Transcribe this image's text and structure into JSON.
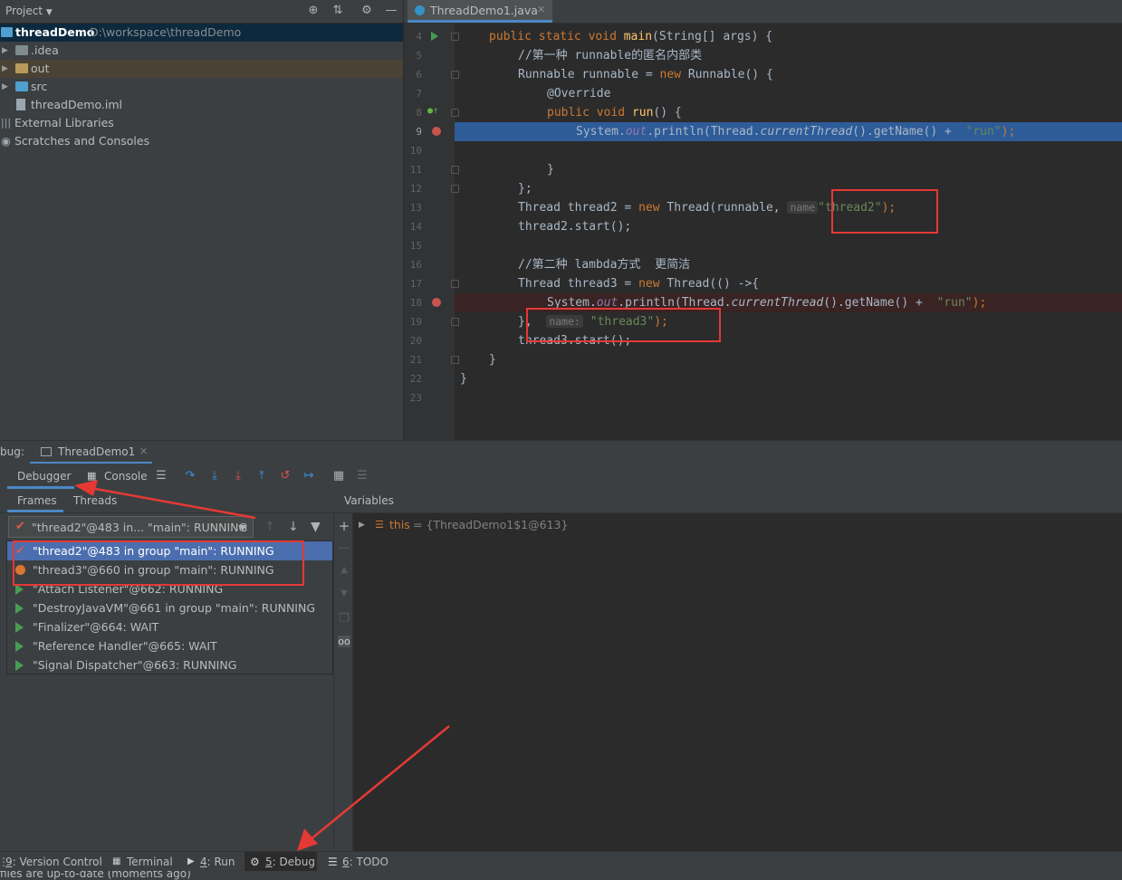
{
  "project": {
    "title": "Project",
    "root_name": "threadDemo",
    "root_path": "D:\\workspace\\threadDemo",
    "items": [
      ".idea",
      "out",
      "src",
      "threadDemo.iml"
    ],
    "external_libraries": "External Libraries",
    "scratches": "Scratches and Consoles"
  },
  "editor": {
    "tab_label": "ThreadDemo1.java",
    "line_numbers": [
      "4",
      "5",
      "6",
      "7",
      "8",
      "9",
      "10",
      "11",
      "12",
      "13",
      "14",
      "15",
      "16",
      "17",
      "18",
      "19",
      "20",
      "21",
      "22",
      "23"
    ],
    "lines": {
      "l4_public": "public",
      "l4_static": "static",
      "l4_void": "void",
      "l4_main": "main",
      "l4_rest": "(String[] args) {",
      "l5_comment": "//第一种 runnable的匿名内部类",
      "l6_type": "Runnable runnable = ",
      "l6_new": "new",
      "l6_rest": " Runnable() {",
      "l7_ann": "@Override",
      "l8_public": "public",
      "l8_void": "void",
      "l8_run": "run",
      "l8_rest": "() {",
      "l9_a": "System.",
      "l9_out": "out",
      "l9_b": ".println(Thread.",
      "l9_cur": "currentThread",
      "l9_c": "().getName() +  ",
      "l9_str": "\"run\"",
      "l9_d": ");",
      "l11": "}",
      "l12": "};",
      "l13_a": "Thread thread2 = ",
      "l13_new": "new",
      "l13_b": " Thread(runnable, ",
      "l13_hint": "name",
      "l13_str": "\"thread2\"",
      "l13_c": ");",
      "l14": "thread2.start();",
      "l16_comment": "//第二种 lambda方式  更简洁",
      "l17_a": "Thread thread3 = ",
      "l17_new": "new",
      "l17_b": " Thread(() ->{",
      "l18_a": "System.",
      "l18_out": "out",
      "l18_b": ".println(Thread.",
      "l18_cur": "currentThread",
      "l18_c": "().getName() +  ",
      "l18_str": "\"run\"",
      "l18_d": ");",
      "l19_a": "},",
      "l19_hint": "name:",
      "l19_str": "\"thread3\"",
      "l19_b": ");",
      "l20": "thread3.start();",
      "l21": "}",
      "l22": "}"
    }
  },
  "debug": {
    "label": "bug:",
    "tab_label": "ThreadDemo1",
    "debugger_tab": "Debugger",
    "console_tab": "Console",
    "frames_tab": "Frames",
    "threads_tab": "Threads",
    "variables_label": "Variables",
    "combo_value": "\"thread2\"@483 in... \"main\": RUNNING",
    "threads": [
      "\"thread2\"@483 in group \"main\": RUNNING",
      "\"thread3\"@660 in group \"main\": RUNNING",
      "\"Attach Listener\"@662: RUNNING",
      "\"DestroyJavaVM\"@661 in group \"main\": RUNNING",
      "\"Finalizer\"@664: WAIT",
      "\"Reference Handler\"@665: WAIT",
      "\"Signal Dispatcher\"@663: RUNNING"
    ],
    "var_name": "this",
    "var_value": "= {ThreadDemo1$1@613}"
  },
  "bottom_bar": {
    "version_control_num": "9",
    "version_control": ": Version Control",
    "terminal": "Terminal",
    "run_num": "4",
    "run": ": Run",
    "debug_num": "5",
    "debug": ": Debug",
    "todo_num": "6",
    "todo": ": TODO"
  },
  "status": "files are up-to-date (moments ago)",
  "colors": {
    "selection_blue": "#2d5c99",
    "annotation_red": "#e53935",
    "accent": "#4a88c7"
  }
}
